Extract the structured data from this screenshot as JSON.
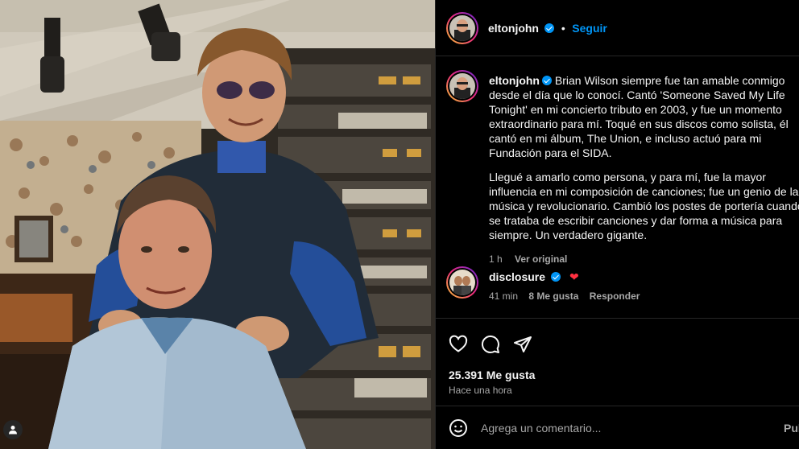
{
  "post": {
    "author": "eltonjohn",
    "follow_label": "Seguir",
    "separator": "•",
    "caption_author": "eltonjohn",
    "caption_p1": "Brian Wilson siempre fue tan amable conmigo desde el día que lo conocí. Cantó 'Someone Saved My Life Tonight' en mi concierto tributo en 2003, y fue un momento extraordinario para mí. Toqué en sus discos como solista, él cantó en mi álbum, The Union, e incluso actuó para mi Fundación para el SIDA.",
    "caption_p2": "Llegué a amarlo como persona, y para mí, fue la mayor influencia en mi composición de canciones; fue un genio de la música y revolucionario. Cambió los postes de portería cuando se trataba de escribir canciones y dar forma a música para siempre. Un verdadero gigante.",
    "caption_time": "1 h",
    "see_translation": "Ver original"
  },
  "comment": {
    "author": "disclosure",
    "emoji": "❤",
    "time": "41 min",
    "likes": "8 Me gusta",
    "reply": "Responder"
  },
  "stats": {
    "likes": "25.391 Me gusta",
    "when": "Hace una hora"
  },
  "comment_box": {
    "placeholder": "Agrega un comentario...",
    "post_label": "Pub"
  },
  "icons": {
    "like": "heart-icon",
    "comment": "comment-icon",
    "share": "share-icon",
    "emoji": "emoji-icon",
    "verified": "verified-badge-icon",
    "user": "user-icon"
  },
  "colors": {
    "accent": "#0095f6",
    "heart": "#ff3040",
    "background": "#000000",
    "muted": "#a8a8a8"
  }
}
